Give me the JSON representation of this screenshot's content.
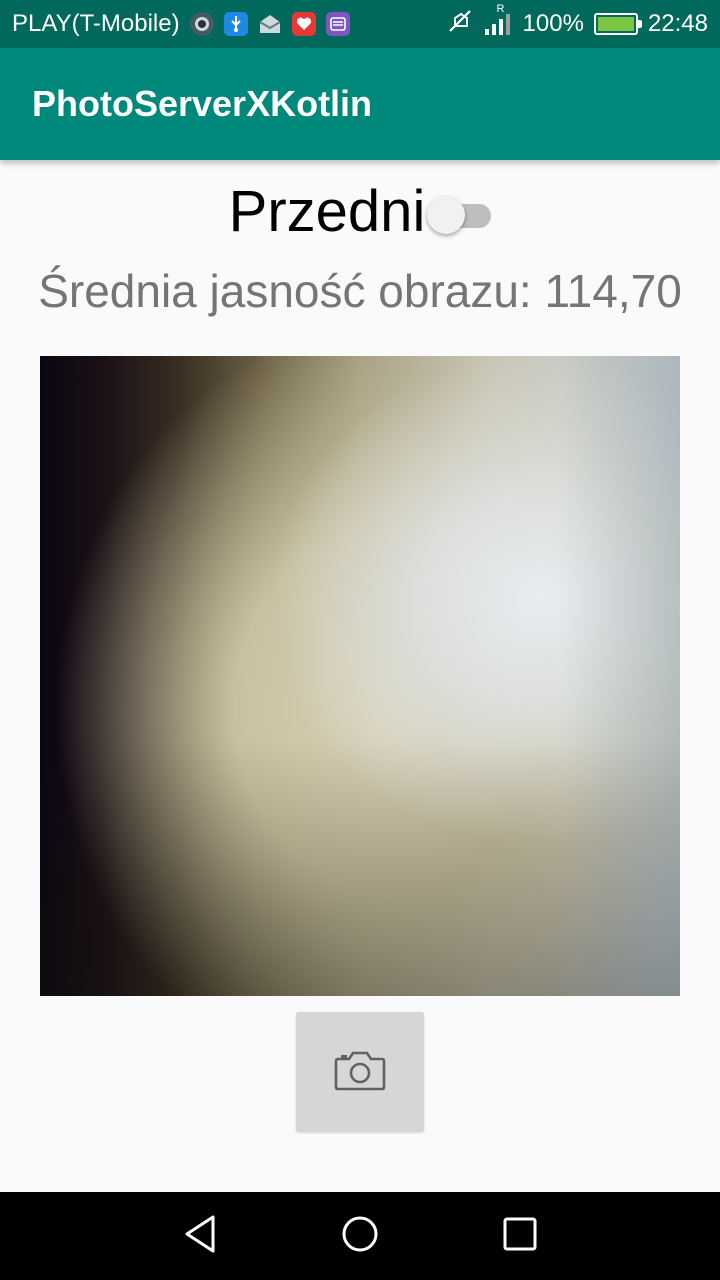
{
  "status_bar": {
    "carrier": "PLAY(T-Mobile)",
    "battery_percent": "100%",
    "time": "22:48",
    "roaming_indicator": "R",
    "notification_icons": [
      "camera-icon",
      "usb-icon",
      "mail-icon",
      "health-icon",
      "message-icon"
    ],
    "system_icons": [
      "mute-icon",
      "signal-icon",
      "battery-charging-icon"
    ]
  },
  "app_bar": {
    "title": "PhotoServerXKotlin"
  },
  "camera_switch": {
    "label": "Przedni",
    "checked": false
  },
  "brightness": {
    "text": "Średnia jasność obrazu: 114,70"
  },
  "capture_button": {
    "icon": "camera-icon"
  },
  "nav_bar": {
    "buttons": [
      "back-icon",
      "home-icon",
      "recents-icon"
    ]
  },
  "colors": {
    "status_bar": "#00695c",
    "app_bar": "#00897b",
    "background": "#fafafa",
    "brightness_text": "#757575",
    "button": "#d6d6d6",
    "nav_bar": "#000000"
  }
}
